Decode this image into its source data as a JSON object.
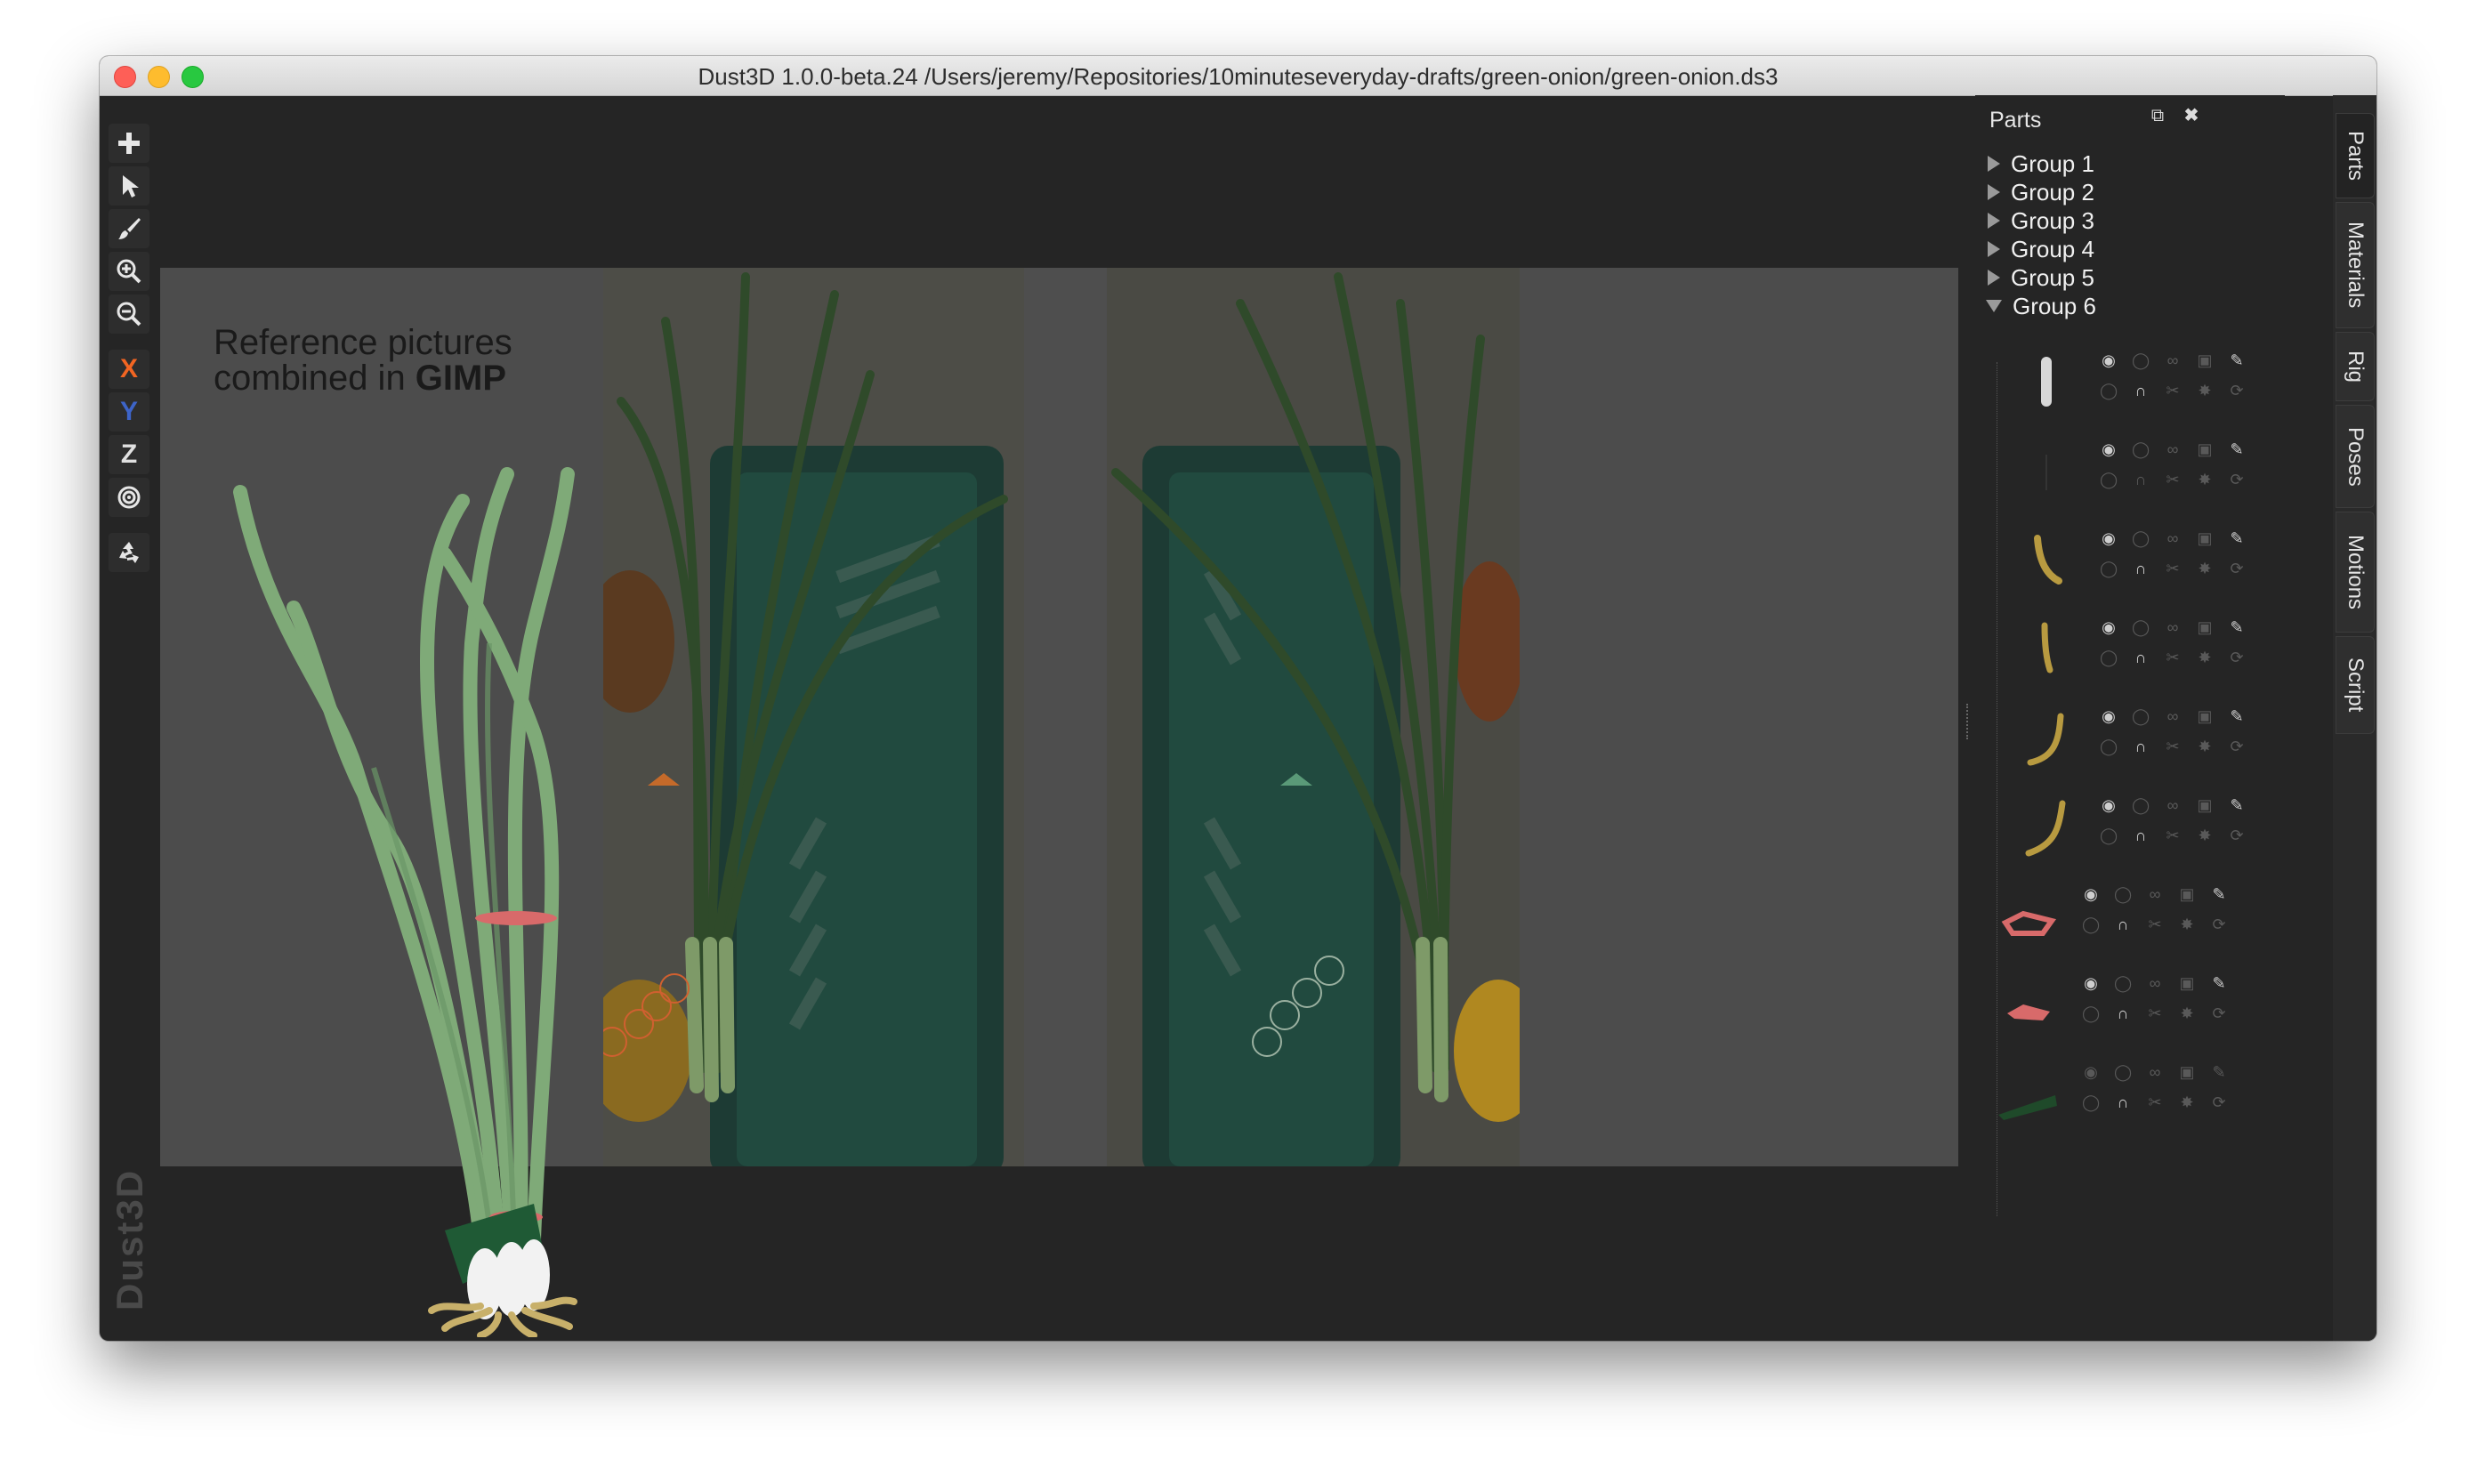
{
  "window": {
    "title": "Dust3D 1.0.0-beta.24 /Users/jeremy/Repositories/10minuteseveryday-drafts/green-onion/green-onion.ds3"
  },
  "toolbar": {
    "add_icon": "plus-icon",
    "select_icon": "pointer-icon",
    "paint_icon": "brush-icon",
    "zoom_in_icon": "zoom-in-icon",
    "zoom_out_icon": "zoom-out-icon",
    "x_label": "X",
    "y_label": "Y",
    "z_label": "Z",
    "radius_icon": "target-icon",
    "recycle_icon": "recycle-icon",
    "x_color": "#f26522",
    "y_color": "#3d64c8",
    "z_color": "#e0e0e0"
  },
  "branding": {
    "watermark": "Dust3D"
  },
  "canvas": {
    "ref_line1": "Reference pictures",
    "ref_line2_prefix": "combined in ",
    "ref_line2_bold": "GIMP"
  },
  "parts_panel": {
    "title": "Parts",
    "groups": [
      {
        "label": "Group 1",
        "expanded": false
      },
      {
        "label": "Group 2",
        "expanded": false
      },
      {
        "label": "Group 3",
        "expanded": false
      },
      {
        "label": "Group 4",
        "expanded": false
      },
      {
        "label": "Group 5",
        "expanded": false
      },
      {
        "label": "Group 6",
        "expanded": true
      }
    ]
  },
  "side_tabs": [
    {
      "label": "Parts",
      "active": true
    },
    {
      "label": "Materials",
      "active": false
    },
    {
      "label": "Rig",
      "active": false
    },
    {
      "label": "Poses",
      "active": false
    },
    {
      "label": "Motions",
      "active": false
    },
    {
      "label": "Script",
      "active": false
    }
  ]
}
